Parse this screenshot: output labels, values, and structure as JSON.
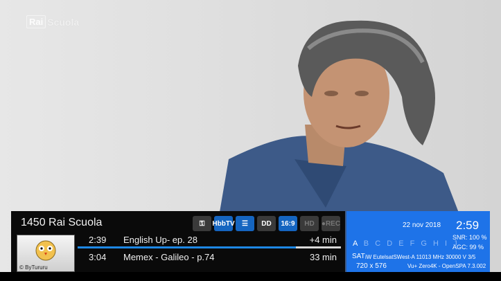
{
  "overlay": {
    "logo_mark": "Rai",
    "logo_text": "Scuola"
  },
  "infobar": {
    "channel": "1450 Rai Scuola",
    "icons": [
      {
        "name": "key-icon",
        "label": "⚿",
        "state": "off"
      },
      {
        "name": "hbbtv-icon",
        "label": "HbbTV",
        "state": "on"
      },
      {
        "name": "teletext-icon",
        "label": "☰",
        "state": "on"
      },
      {
        "name": "dolby-icon",
        "label": "DD",
        "state": "off"
      },
      {
        "name": "aspect-icon",
        "label": "16:9",
        "state": "on"
      },
      {
        "name": "hd-icon",
        "label": "HD",
        "state": "off"
      },
      {
        "name": "rec-icon",
        "label": "●REC",
        "state": "off"
      }
    ],
    "picon_caption": "© ByTururu",
    "events": [
      {
        "time": "2:39",
        "title": "English Up- ep. 28",
        "duration": "+4 min"
      },
      {
        "time": "3:04",
        "title": "Memex - Galileo - p.74",
        "duration": "33 min"
      }
    ],
    "progress_percent": 83
  },
  "panel": {
    "date": "22 nov 2018",
    "time": "2:59",
    "snr": "SNR:  100 %",
    "agc": "AGC:  99 %",
    "letters_active": "A",
    "letters_rest": "B C D E F G H I J",
    "sat_label": "SAT",
    "sat_info": "iW EutelsatSWest-A 11013 MHz 30000 V 3/5",
    "resolution": "720 x 576",
    "image_info": "Vu+ Zero4K - OpenSPA 7.3.002"
  }
}
